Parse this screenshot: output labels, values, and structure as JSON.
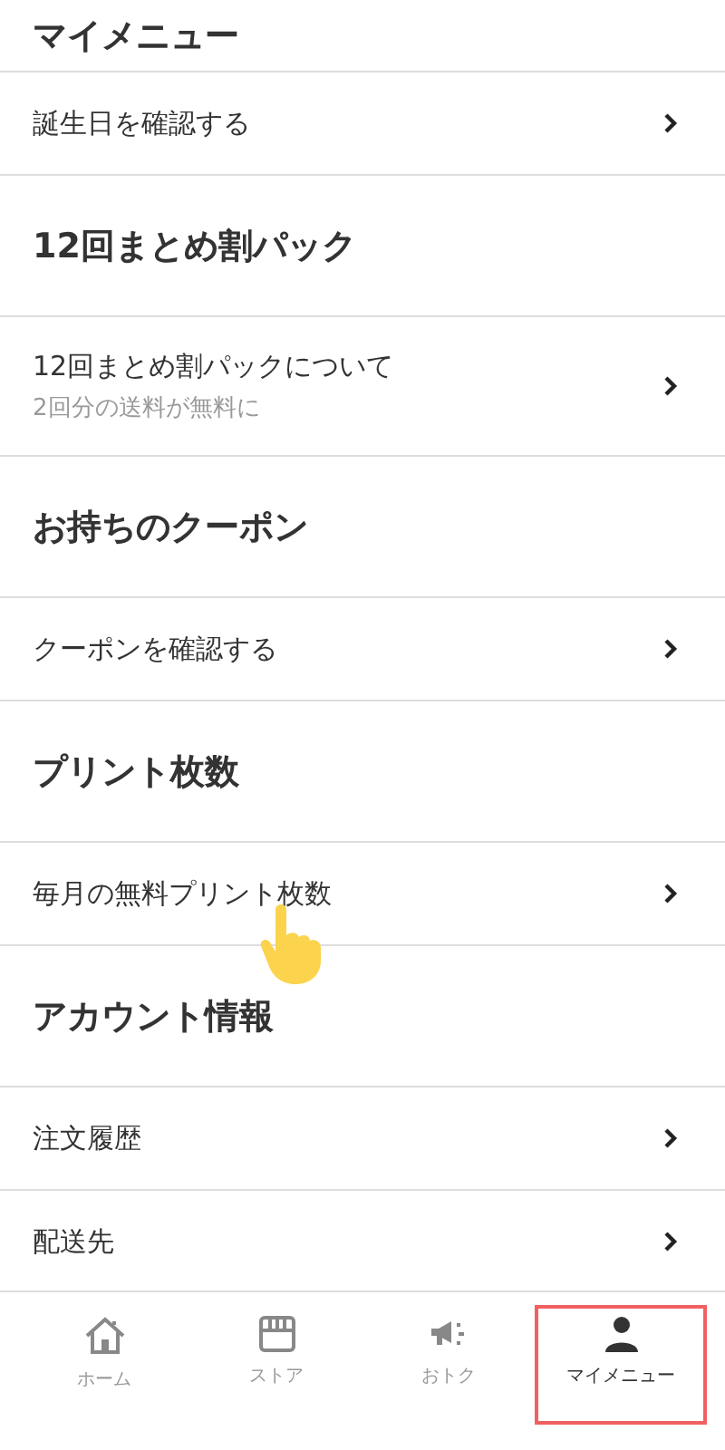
{
  "sections": [
    {
      "title": "マイメニュー",
      "items": [
        {
          "label": "誕生日を確認する"
        }
      ]
    },
    {
      "title": "12回まとめ割パック",
      "items": [
        {
          "label": "12回まとめ割パックについて",
          "subtitle": "2回分の送料が無料に"
        }
      ]
    },
    {
      "title": "お持ちのクーポン",
      "items": [
        {
          "label": "クーポンを確認する"
        }
      ]
    },
    {
      "title": "プリント枚数",
      "items": [
        {
          "label": "毎月の無料プリント枚数"
        }
      ]
    },
    {
      "title": "アカウント情報",
      "items": [
        {
          "label": "注文履歴"
        },
        {
          "label": "配送先"
        }
      ]
    }
  ],
  "tabs": [
    {
      "kind": "home",
      "label": "ホーム",
      "selected": false
    },
    {
      "kind": "store",
      "label": "ストア",
      "selected": false
    },
    {
      "kind": "deals",
      "label": "おトク",
      "selected": false
    },
    {
      "kind": "mymenu",
      "label": "マイメニュー",
      "selected": true
    }
  ]
}
